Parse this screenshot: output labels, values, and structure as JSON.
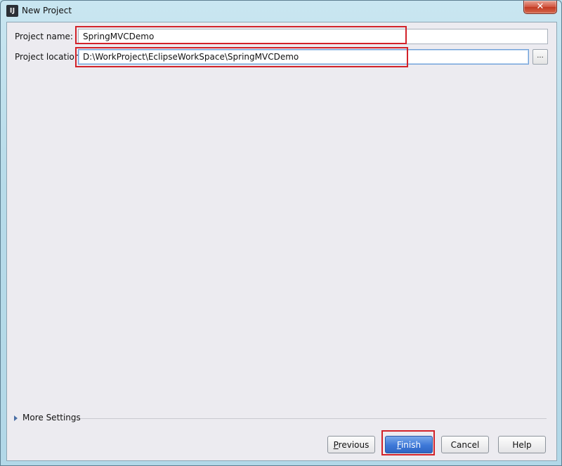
{
  "window": {
    "title": "New Project",
    "app_icon_text": "IJ",
    "close_glyph": "✕"
  },
  "form": {
    "project_name_label": "Project name:",
    "project_name_value": "SpringMVCDemo",
    "project_location_label": "Project location:",
    "project_location_value": "D:\\WorkProject\\EclipseWorkSpace\\SpringMVCDemo",
    "browse_label": "..."
  },
  "more_settings": {
    "label": "More Settings"
  },
  "buttons": {
    "previous": "Previous",
    "finish": "Finish",
    "cancel": "Cancel",
    "help": "Help"
  },
  "colors": {
    "highlight": "#d2222a",
    "primary_button": "#3d78d8"
  }
}
